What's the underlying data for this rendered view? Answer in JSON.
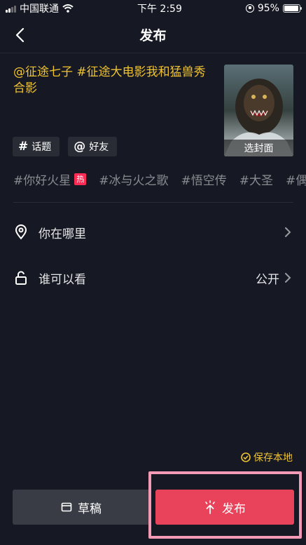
{
  "status_bar": {
    "carrier": "中国联通",
    "time": "下午 2:59",
    "battery": "95%",
    "battery_level": 0.95,
    "icons": [
      "signal-icon",
      "wifi-icon",
      "rotation-lock-icon",
      "battery-icon"
    ]
  },
  "nav": {
    "title": "发布",
    "back_icon": "chevron-left-icon"
  },
  "post": {
    "caption": "@征途七子 #征途大电影我和猛兽秀合影",
    "cover_button": "选封面"
  },
  "tag_buttons": [
    {
      "symbol": "#",
      "label": "话题",
      "icon": "hashtag-icon"
    },
    {
      "symbol": "@",
      "label": "好友",
      "icon": "at-icon"
    }
  ],
  "suggested_tags": [
    {
      "label": "#你好火星",
      "badge": "热"
    },
    {
      "label": "#冰与火之歌",
      "badge": ""
    },
    {
      "label": "#悟空传",
      "badge": ""
    },
    {
      "label": "#大圣",
      "badge": ""
    },
    {
      "label": "#偶",
      "badge": ""
    }
  ],
  "settings": {
    "location": {
      "label": "你在哪里",
      "icon": "location-pin-icon"
    },
    "visibility": {
      "label": "谁可以看",
      "value": "公开",
      "icon": "unlock-icon"
    }
  },
  "save_local": {
    "label": "保存本地",
    "checked": true
  },
  "actions": {
    "draft_label": "草稿",
    "draft_icon": "draft-box-icon",
    "publish_label": "发布",
    "publish_icon": "upload-arrow-icon"
  },
  "colors": {
    "background": "#161823",
    "accent_yellow": "#f0c331",
    "publish_red": "#e9435b",
    "highlight_pink": "#f39ab6"
  }
}
